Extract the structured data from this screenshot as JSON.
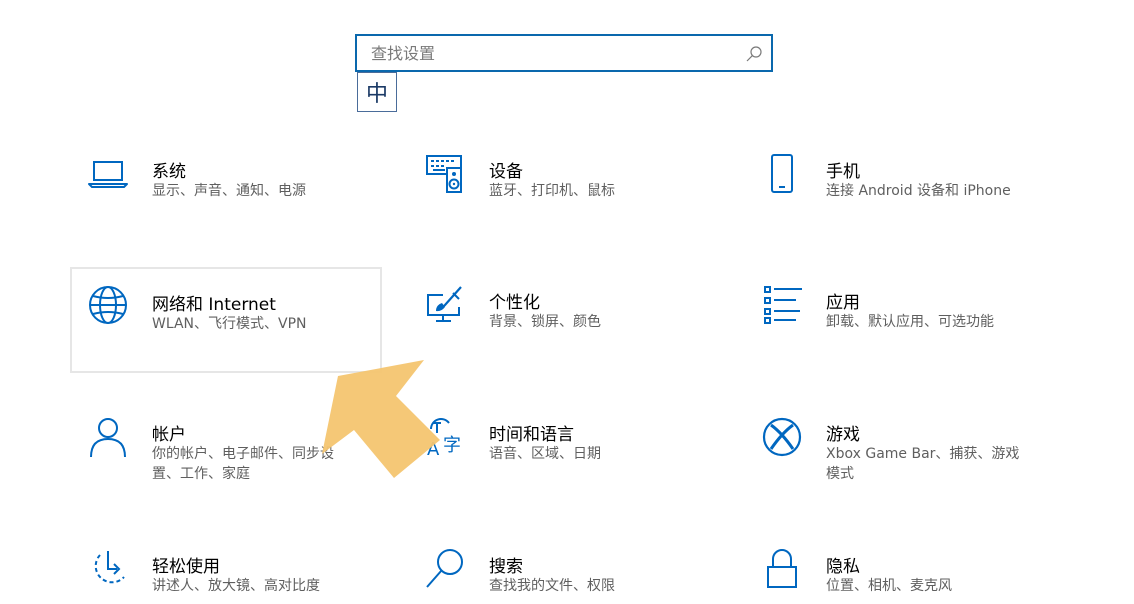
{
  "search": {
    "placeholder": "查找设置"
  },
  "ime": {
    "mode_label": "中"
  },
  "colors": {
    "accent": "#0a68ad",
    "icon": "#0067c0",
    "title": "#000000",
    "description": "#5f5f5f",
    "arrow": "#f4c570"
  },
  "categories": [
    {
      "id": "system",
      "title": "系统",
      "description": "显示、声音、通知、电源",
      "icon": "laptop-icon"
    },
    {
      "id": "devices",
      "title": "设备",
      "description": "蓝牙、打印机、鼠标",
      "icon": "keyboard-speaker-icon"
    },
    {
      "id": "phone",
      "title": "手机",
      "description": "连接 Android 设备和 iPhone",
      "icon": "phone-icon"
    },
    {
      "id": "network",
      "title": "网络和 Internet",
      "description": "WLAN、飞行模式、VPN",
      "icon": "globe-icon",
      "highlighted": true
    },
    {
      "id": "personalization",
      "title": "个性化",
      "description": "背景、锁屏、颜色",
      "icon": "paint-monitor-icon"
    },
    {
      "id": "apps",
      "title": "应用",
      "description": "卸载、默认应用、可选功能",
      "icon": "apps-list-icon"
    },
    {
      "id": "accounts",
      "title": "帐户",
      "description_lines": [
        "你的帐户、电子邮件、同步设",
        "置、工作、家庭"
      ],
      "icon": "person-icon"
    },
    {
      "id": "time-language",
      "title": "时间和语言",
      "description": "语音、区域、日期",
      "icon": "language-icon"
    },
    {
      "id": "gaming",
      "title": "游戏",
      "description_lines": [
        "Xbox Game Bar、捕获、游戏",
        "模式"
      ],
      "icon": "xbox-icon"
    },
    {
      "id": "ease-of-access",
      "title": "轻松使用",
      "description": "讲述人、放大镜、高对比度",
      "icon": "ease-of-access-icon"
    },
    {
      "id": "search",
      "title": "搜索",
      "description": "查找我的文件、权限",
      "icon": "search-icon"
    },
    {
      "id": "privacy",
      "title": "隐私",
      "description": "位置、相机、麦克风",
      "icon": "lock-icon"
    }
  ]
}
